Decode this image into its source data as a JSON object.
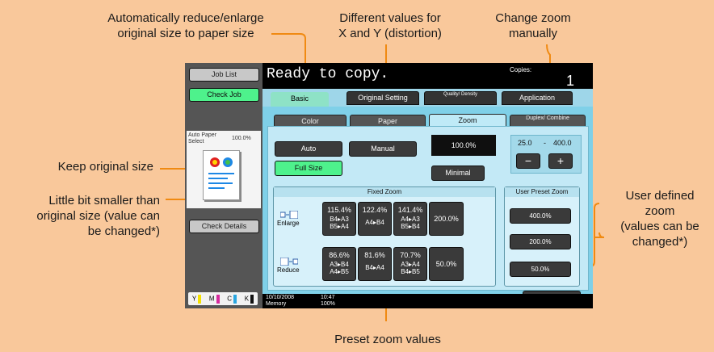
{
  "annotations": {
    "auto": "Automatically reduce/enlarge\noriginal size to paper size",
    "distortion": "Different values for\nX and Y (distortion)",
    "manual": "Change zoom\nmanually",
    "keep": "Keep original size",
    "smaller": "Little bit smaller than\noriginal size (value can\nbe changed*)",
    "user": "User defined\nzoom\n(values can be\nchanged*)",
    "preset": "Preset zoom values"
  },
  "left_panel": {
    "job_list": "Job List",
    "check_job": "Check Job",
    "auto_paper": "Auto Paper Select",
    "auto_paper_value": "100.0%",
    "check_details": "Check Details",
    "toner": [
      "Y",
      "M",
      "C",
      "K"
    ],
    "toner_colors": [
      "#f5e100",
      "#d72a9d",
      "#2aa6e0",
      "#111111"
    ]
  },
  "header": {
    "status": "Ready to copy.",
    "copies_label": "Copies:",
    "copies_value": "1"
  },
  "tabs": [
    "Basic",
    "Original Setting",
    "Quality/ Density",
    "Application"
  ],
  "subtabs": [
    "Color",
    "Paper",
    "Zoom",
    "Duplex/ Combine"
  ],
  "zoom": {
    "auto": "Auto",
    "manual": "Manual",
    "current": "100.0%",
    "range_min": "25.0",
    "range_sep": "-",
    "range_max": "400.0",
    "minus": "−",
    "plus": "+",
    "full_size": "Full Size",
    "minimal": "Minimal"
  },
  "fixed_zoom": {
    "title": "Fixed Zoom",
    "enlarge_label": "Enlarge",
    "reduce_label": "Reduce",
    "enlarge": [
      {
        "pct": "115.4%",
        "paper": "B4▸A3\nB5▸A4"
      },
      {
        "pct": "122.4%",
        "paper": "A4▸B4"
      },
      {
        "pct": "141.4%",
        "paper": "A4▸A3\nB5▸B4"
      }
    ],
    "enlarge_big": "200.0%",
    "reduce": [
      {
        "pct": "86.6%",
        "paper": "A3▸B4\nA4▸B5"
      },
      {
        "pct": "81.6%",
        "paper": "B4▸A4"
      },
      {
        "pct": "70.7%",
        "paper": "A3▸A4\nB4▸B5"
      }
    ],
    "reduce_big": "50.0%"
  },
  "user_preset": {
    "title": "User Preset Zoom",
    "values": [
      "400.0%",
      "200.0%",
      "50.0%"
    ]
  },
  "ok": "OK",
  "status_bar": {
    "date": "10/10/2008",
    "time": "10:47",
    "memory_label": "Memory",
    "memory_value": "100%"
  }
}
